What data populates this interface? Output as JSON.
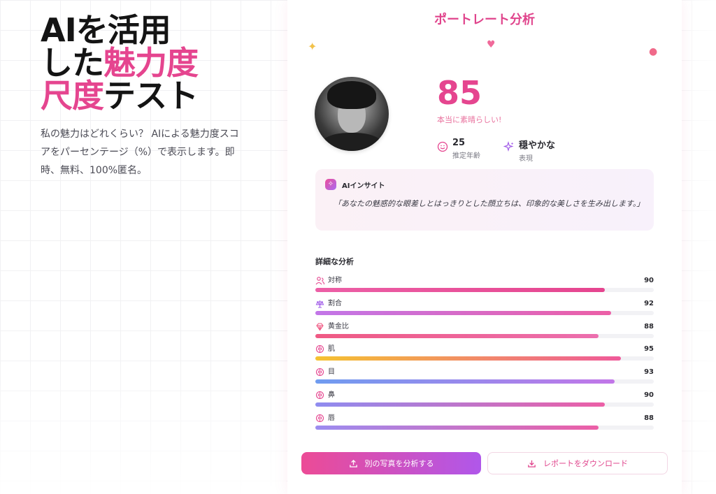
{
  "hero": {
    "title_line1": "AIを活用",
    "title_line2_plain": "した",
    "title_line2_pink": "魅力度",
    "title_line3_pink": "尺度",
    "title_line3_plain": "テスト",
    "description": "私の魅力はどれくらい？ AIによる魅力度スコアをパーセンテージ（%）で表示します。即時、無料、100%匿名。"
  },
  "card": {
    "title": "ポートレート分析",
    "score": "85",
    "score_caption": "本当に素晴らしい!",
    "age_value": "25",
    "age_label": "推定年齢",
    "expression_value": "穏やかな",
    "expression_label": "表現",
    "insight_title": "AIインサイト",
    "insight_quote": "「あなたの魅惑的な眼差しとはっきりとした顔立ちは、印象的な美しさを生み出します。」",
    "detail_title": "詳細な分析",
    "metrics": [
      {
        "name": "対称",
        "value": 90,
        "icon": "users-icon",
        "gradient": [
          "#ec5fa6",
          "#e5458f"
        ]
      },
      {
        "name": "割合",
        "value": 92,
        "icon": "scale-icon",
        "gradient": [
          "#c276e8",
          "#ec5fa6"
        ]
      },
      {
        "name": "黄金比",
        "value": 88,
        "icon": "gem-icon",
        "gradient": [
          "#ef5a84",
          "#ec6fae"
        ]
      },
      {
        "name": "肌",
        "value": 95,
        "icon": "brain-icon",
        "gradient": [
          "#f5c230",
          "#ef5a9a"
        ]
      },
      {
        "name": "目",
        "value": 93,
        "icon": "brain-icon",
        "gradient": [
          "#6f9cf0",
          "#c276e8"
        ]
      },
      {
        "name": "鼻",
        "value": 90,
        "icon": "brain-icon",
        "gradient": [
          "#8f8cf0",
          "#ec5fa6"
        ]
      },
      {
        "name": "唇",
        "value": 88,
        "icon": "brain-icon",
        "gradient": [
          "#9c8cf0",
          "#ec5fa6"
        ]
      }
    ],
    "btn_analyze": "別の写真を分析する",
    "btn_download": "レポートをダウンロード"
  },
  "colors": {
    "accent": "#e5458f",
    "purple": "#b057ea"
  }
}
